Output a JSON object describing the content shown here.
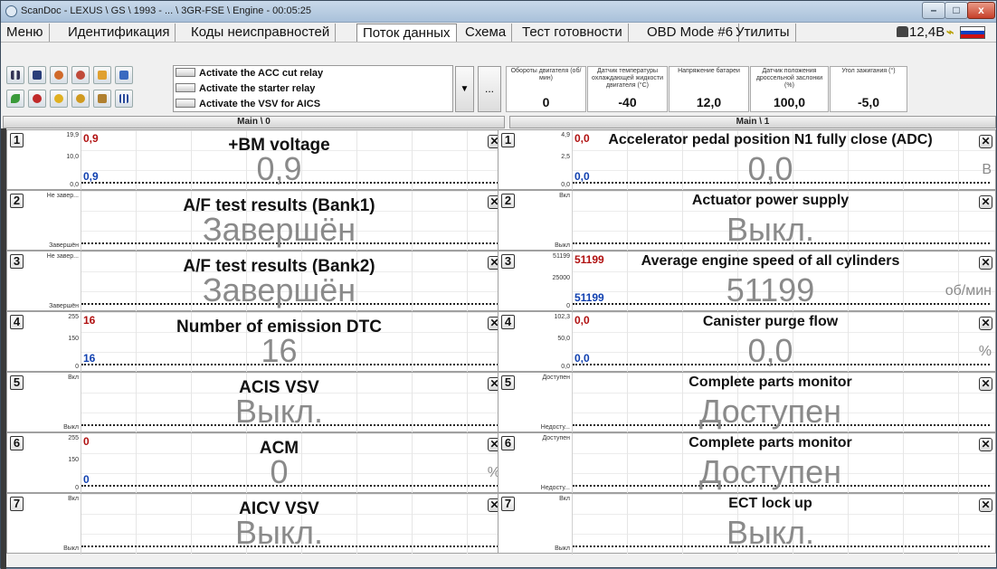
{
  "window": {
    "title": "ScanDoc - LEXUS \\ GS \\ 1993 - ... \\ 3GR-FSE \\ Engine - 00:05:25",
    "min": "–",
    "max": "□",
    "close": "x"
  },
  "menu": {
    "items": [
      "Меню",
      "Идентификация",
      "Коды неисправностей",
      "Поток данных",
      "Схема",
      "Тест готовности",
      "OBD Mode #6",
      "Утилиты"
    ],
    "active": "Поток данных",
    "voltage": "12,4В"
  },
  "toolbar": {
    "icons": [
      "pause-icon",
      "save-icon",
      "settings-icon",
      "settings-alt-icon",
      "folder-icon",
      "recycle-icon",
      "leaf-icon",
      "record-icon",
      "zoom-in-icon",
      "zoom-out-icon",
      "zoom-fit-icon",
      "grid-icon"
    ],
    "actions": [
      "Activate the ACC cut relay",
      "Activate the starter relay",
      "Activate the VSV for AICS"
    ],
    "more": "..."
  },
  "quick_params": [
    {
      "header": "Обороты двигателя (об/мин)",
      "value": "0"
    },
    {
      "header": "Датчик температуры охлаждающей жидкости двигателя (°C)",
      "value": "-40"
    },
    {
      "header": "Напряжение батареи",
      "value": "12,0"
    },
    {
      "header": "Датчик положения дроссельной заслонки (%)",
      "value": "100,0"
    },
    {
      "header": "Угол зажигания (°)",
      "value": "-5,0"
    }
  ],
  "columns": {
    "left": "Main \\ 0",
    "right": "Main \\ 1"
  },
  "left_panels": [
    {
      "num": "1",
      "name": "+BM voltage",
      "value": "0,9",
      "unit": "",
      "scale_top": "19,9",
      "scale_mid": "10,0",
      "scale_bot": "0,0",
      "min_label": "0,9",
      "max_label": "0,9"
    },
    {
      "num": "2",
      "name": "A/F test results (Bank1)",
      "value": "Завершён",
      "unit": "",
      "scale_top": "Не завер...",
      "scale_mid": "",
      "scale_bot": "Завершён",
      "min_label": "",
      "max_label": ""
    },
    {
      "num": "3",
      "name": "A/F test results (Bank2)",
      "value": "Завершён",
      "unit": "",
      "scale_top": "Не завер...",
      "scale_mid": "",
      "scale_bot": "Завершён",
      "min_label": "",
      "max_label": ""
    },
    {
      "num": "4",
      "name": "Number of emission DTC",
      "value": "16",
      "unit": "",
      "scale_top": "255",
      "scale_mid": "150",
      "scale_bot": "0",
      "min_label": "16",
      "max_label": "16"
    },
    {
      "num": "5",
      "name": "ACIS VSV",
      "value": "Выкл.",
      "unit": "",
      "scale_top": "Вкл",
      "scale_mid": "",
      "scale_bot": "Выкл",
      "min_label": "",
      "max_label": ""
    },
    {
      "num": "6",
      "name": "ACM",
      "value": "0",
      "unit": "%",
      "scale_top": "255",
      "scale_mid": "150",
      "scale_bot": "0",
      "min_label": "0",
      "max_label": "0"
    },
    {
      "num": "7",
      "name": "AICV VSV",
      "value": "Выкл.",
      "unit": "",
      "scale_top": "Вкл",
      "scale_mid": "",
      "scale_bot": "Выкл",
      "min_label": "",
      "max_label": ""
    }
  ],
  "right_panels": [
    {
      "num": "1",
      "name": "Accelerator pedal position N1 fully close (ADC)",
      "value": "0,0",
      "unit": "В",
      "scale_top": "4,9",
      "scale_mid": "2,5",
      "scale_bot": "0,0",
      "min_label": "0,0",
      "max_label": "0,0"
    },
    {
      "num": "2",
      "name": "Actuator power supply",
      "value": "Выкл.",
      "unit": "",
      "scale_top": "Вкл",
      "scale_mid": "",
      "scale_bot": "Выкл",
      "min_label": "",
      "max_label": ""
    },
    {
      "num": "3",
      "name": "Average engine speed of all cylinders",
      "value": "51199",
      "unit": "об/мин",
      "scale_top": "51199",
      "scale_mid": "25000",
      "scale_bot": "0",
      "min_label": "51199",
      "max_label": "51199"
    },
    {
      "num": "4",
      "name": "Canister purge flow",
      "value": "0,0",
      "unit": "%",
      "scale_top": "102,3",
      "scale_mid": "50,0",
      "scale_bot": "0,0",
      "min_label": "0,0",
      "max_label": "0,0"
    },
    {
      "num": "5",
      "name": "Complete parts monitor",
      "value": "Доступен",
      "unit": "",
      "scale_top": "Доступен",
      "scale_mid": "",
      "scale_bot": "Недосту...",
      "min_label": "",
      "max_label": ""
    },
    {
      "num": "6",
      "name": "Complete parts monitor",
      "value": "Доступен",
      "unit": "",
      "scale_top": "Доступен",
      "scale_mid": "",
      "scale_bot": "Недосту...",
      "min_label": "",
      "max_label": ""
    },
    {
      "num": "7",
      "name": "ECT lock up",
      "value": "Выкл.",
      "unit": "",
      "scale_top": "Вкл",
      "scale_mid": "",
      "scale_bot": "Выкл",
      "min_label": "",
      "max_label": ""
    }
  ],
  "close_glyph": "✕"
}
